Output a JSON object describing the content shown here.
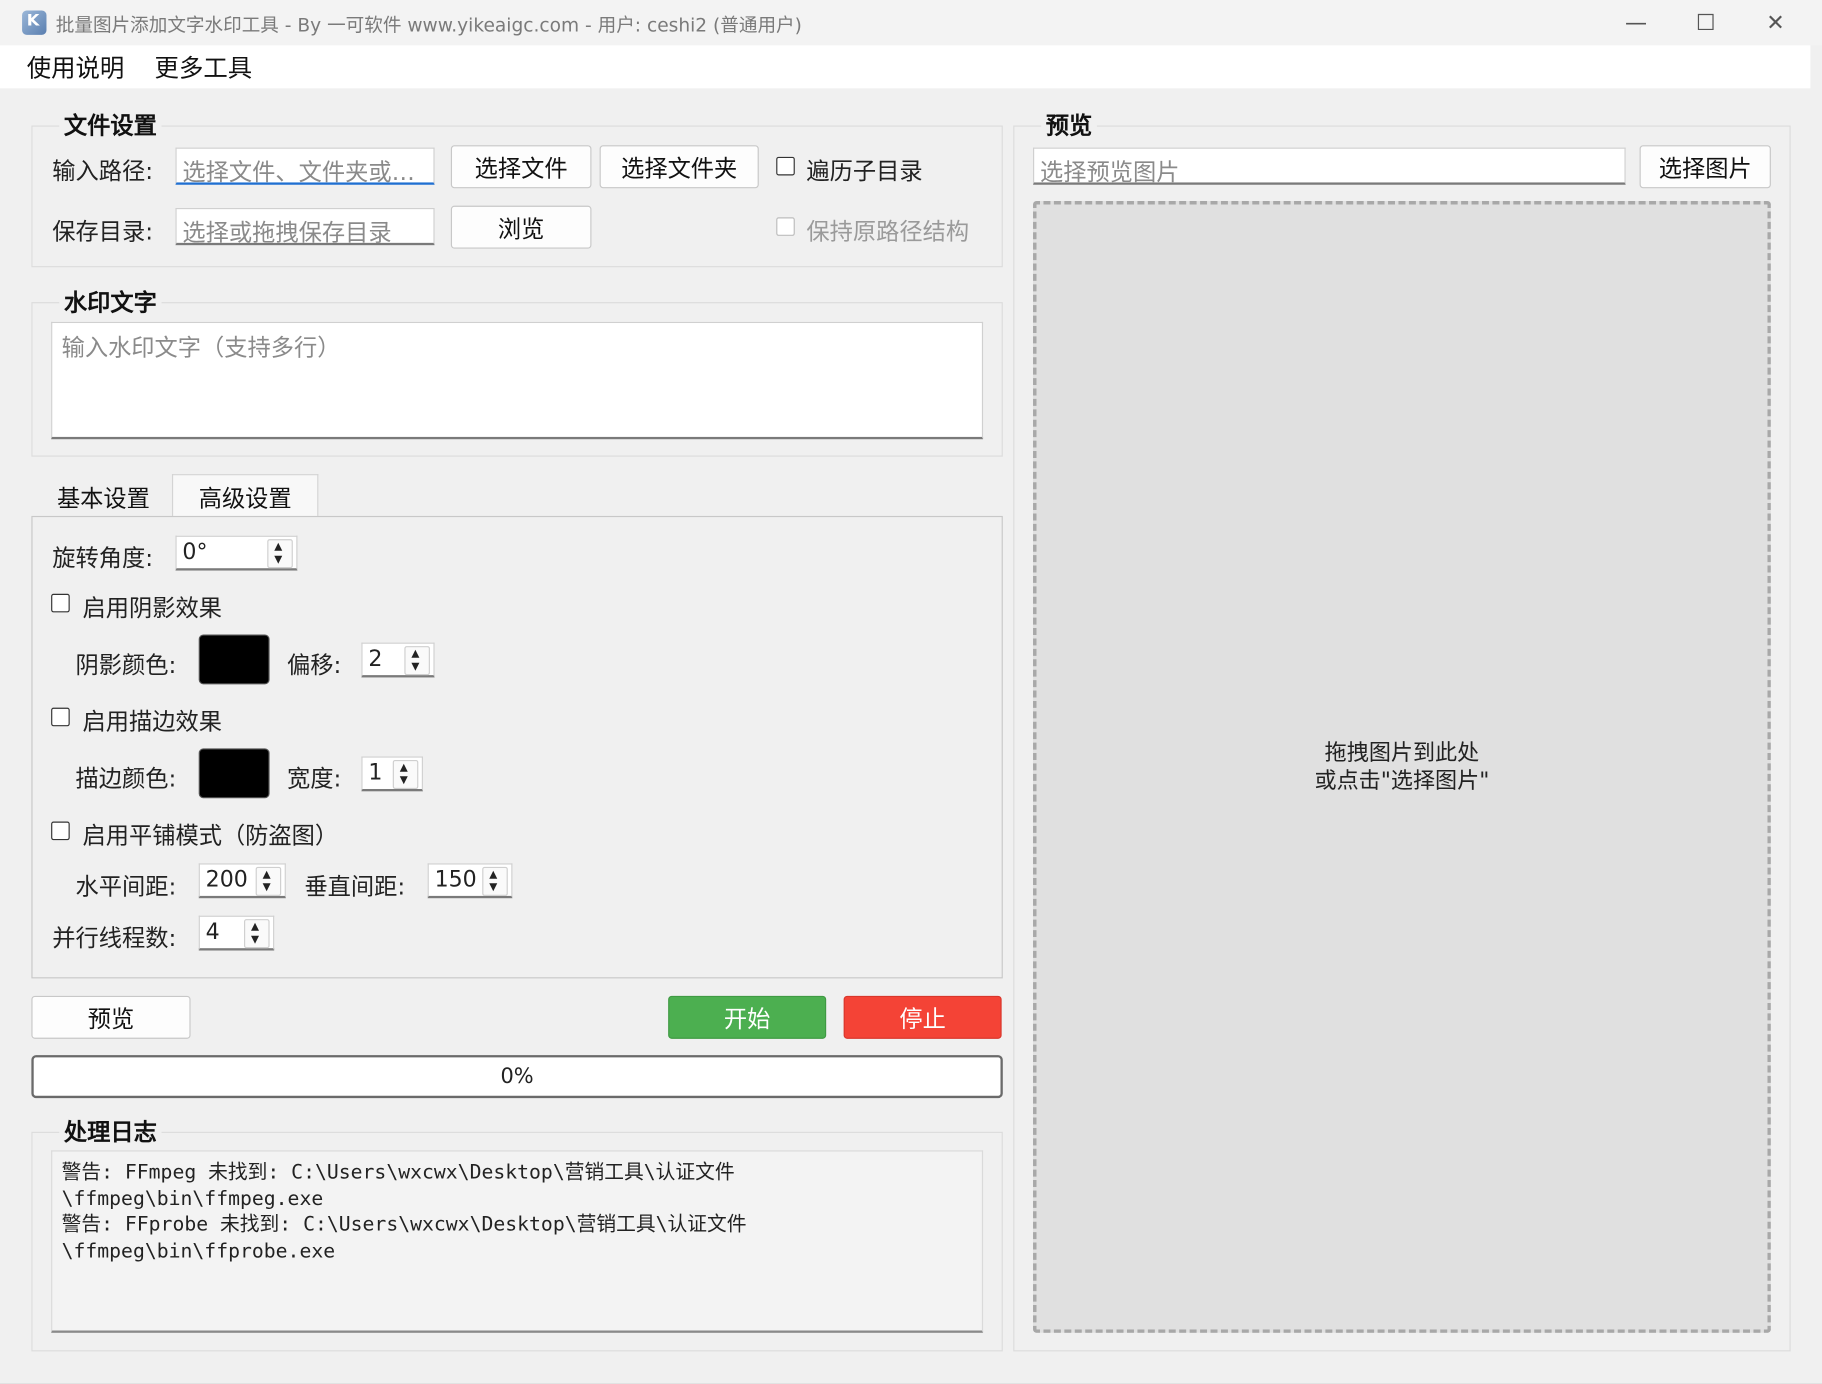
{
  "window": {
    "title": "批量图片添加文字水印工具 - By 一可软件 www.yikeaigc.com - 用户: ceshi2 (普通用户)",
    "minimize_glyph": "—",
    "maximize_glyph": "☐",
    "close_glyph": "✕"
  },
  "menu": {
    "help": "使用说明",
    "more_tools": "更多工具"
  },
  "file_settings": {
    "title": "文件设置",
    "input_label": "输入路径:",
    "input_placeholder": "选择文件、文件夹或…",
    "select_file": "选择文件",
    "select_folder": "选择文件夹",
    "traverse_subdirs": "遍历子目录",
    "save_label": "保存目录:",
    "save_placeholder": "选择或拖拽保存目录",
    "browse": "浏览",
    "keep_structure": "保持原路径结构"
  },
  "watermark_text": {
    "title": "水印文字",
    "placeholder": "输入水印文字（支持多行）"
  },
  "tabs": {
    "basic": "基本设置",
    "advanced": "高级设置"
  },
  "advanced": {
    "rotation_label": "旋转角度:",
    "rotation_value": "0°",
    "shadow_enable": "启用阴影效果",
    "shadow_color_label": "阴影颜色:",
    "offset_label": "偏移:",
    "offset_value": "2",
    "stroke_enable": "启用描边效果",
    "stroke_color_label": "描边颜色:",
    "width_label": "宽度:",
    "width_value": "1",
    "tile_enable": "启用平铺模式（防盗图）",
    "h_spacing_label": "水平间距:",
    "h_spacing_value": "200",
    "v_spacing_label": "垂直间距:",
    "v_spacing_value": "150",
    "threads_label": "并行线程数:",
    "threads_value": "4"
  },
  "actions": {
    "preview": "预览",
    "start": "开始",
    "stop": "停止",
    "progress_text": "0%",
    "progress": 0
  },
  "log": {
    "title": "处理日志",
    "lines": [
      "警告: FFmpeg 未找到: C:\\Users\\wxcwx\\Desktop\\营销工具\\认证文件",
      "\\ffmpeg\\bin\\ffmpeg.exe",
      "警告: FFprobe 未找到: C:\\Users\\wxcwx\\Desktop\\营销工具\\认证文件",
      "\\ffmpeg\\bin\\ffprobe.exe"
    ]
  },
  "preview_panel": {
    "title": "预览",
    "placeholder": "选择预览图片",
    "select_image": "选择图片",
    "drop_hint_line1": "拖拽图片到此处",
    "drop_hint_line2": "或点击\"选择图片\""
  },
  "colors": {
    "start_button": "#4caf50",
    "stop_button": "#f44336",
    "shadow_color": "#000000",
    "stroke_color": "#000000",
    "focus_accent": "#1f6fd1"
  }
}
